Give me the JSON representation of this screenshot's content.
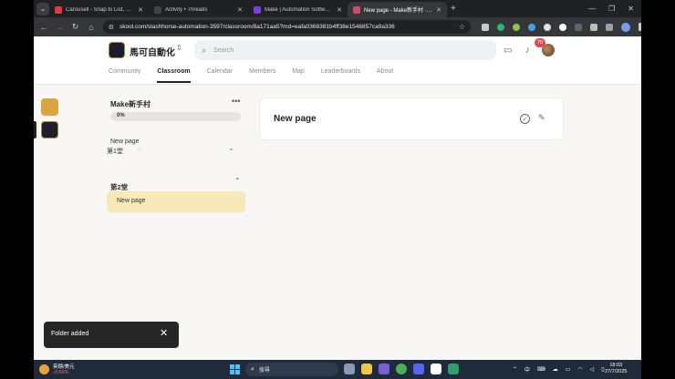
{
  "browser": {
    "tabs": [
      {
        "title": "Carousell - Snap to List, Chat,",
        "active": false,
        "color": "#e23b3b"
      },
      {
        "title": "Activity • Threads",
        "active": false,
        "color": "#444444"
      },
      {
        "title": "Make | Automation Software |",
        "active": false,
        "color": "#7b3fe4"
      },
      {
        "title": "New page - Make新手村 · 馬...",
        "active": true,
        "color": "#cc4c6b"
      }
    ],
    "url": "skool.com/slashhorse-automation-3597/classroom/8a171aa5?md=eafa0368381b4ff38e1546857ca9a336"
  },
  "header": {
    "group_name": "馬可自動化",
    "search_placeholder": "Search",
    "notification_count": "70"
  },
  "nav": {
    "tabs": [
      "Community",
      "Classroom",
      "Calendar",
      "Members",
      "Map",
      "Leaderboards",
      "About"
    ],
    "active": "Classroom"
  },
  "course": {
    "title": "Make新手村",
    "progress_label": "0%",
    "progress": 0,
    "section1_label": "New page",
    "section1_sub": "第1堂",
    "section2_title": "第2堂",
    "lesson_title": "New page"
  },
  "content": {
    "title": "New page"
  },
  "toast": {
    "message": "Folder added"
  },
  "taskbar": {
    "stock_name": "英鎊/美元",
    "stock_change": "-0.56%",
    "search_placeholder": "搜尋",
    "ime": "中",
    "clock_time": "18:03",
    "clock_date": "27/7/2025"
  }
}
